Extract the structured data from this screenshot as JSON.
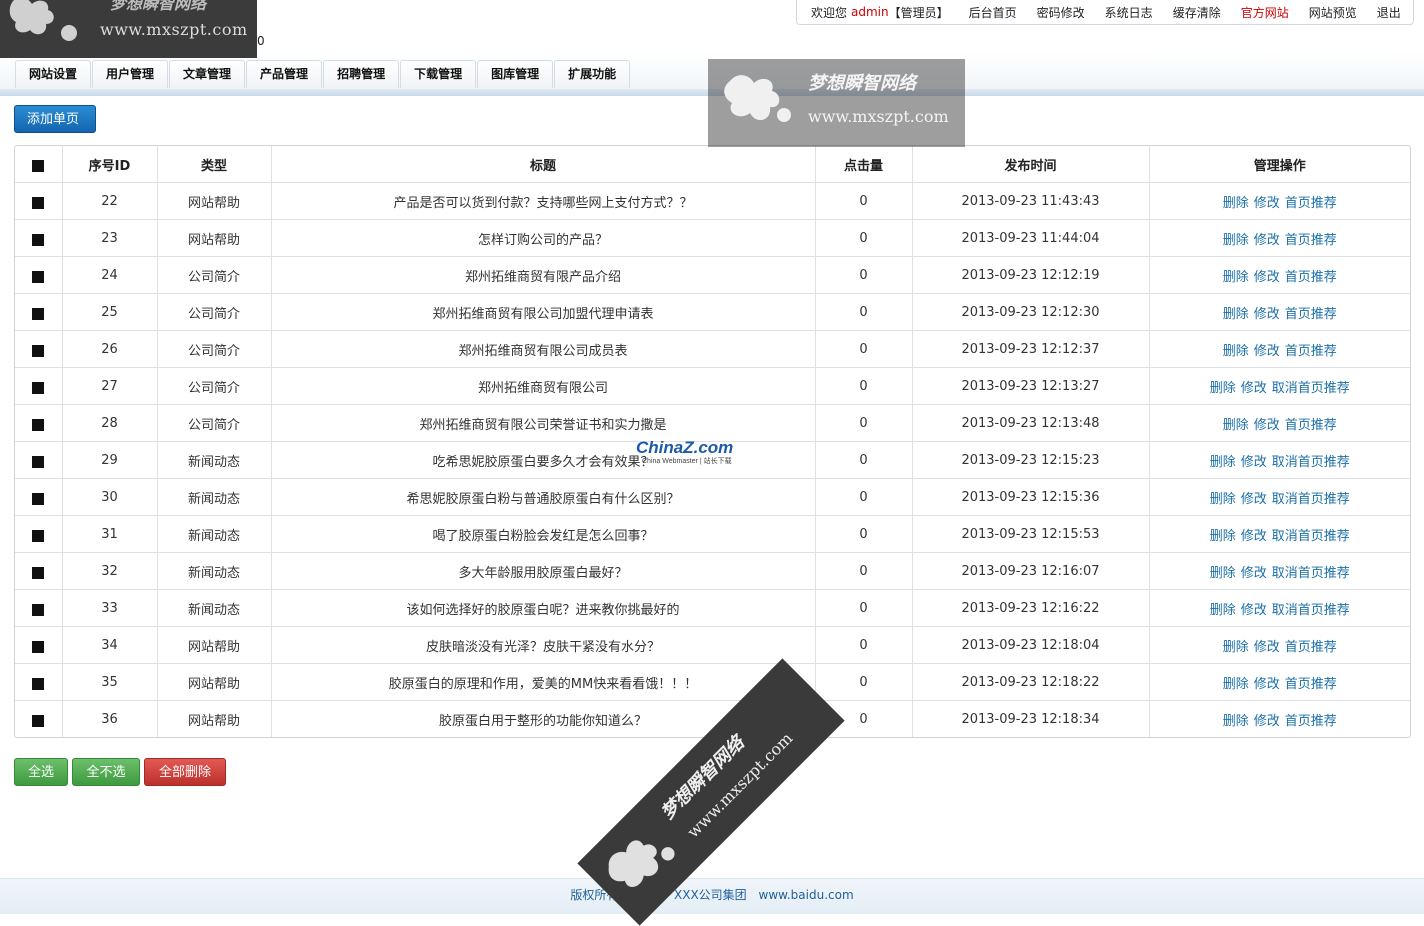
{
  "logo": {
    "url_text": "www.mxszpt.com",
    "tail_text": "0"
  },
  "toplinks": {
    "welcome_prefix": "欢迎您",
    "username": "admin",
    "role": "【管理员】",
    "links": [
      {
        "label": "后台首页"
      },
      {
        "label": "密码修改"
      },
      {
        "label": "系统日志"
      },
      {
        "label": "缓存清除"
      },
      {
        "label": "官方网站",
        "color": "#cc0000"
      },
      {
        "label": "网站预览"
      },
      {
        "label": "退出"
      }
    ]
  },
  "nav": {
    "tabs": [
      {
        "label": "网站设置"
      },
      {
        "label": "用户管理"
      },
      {
        "label": "文章管理"
      },
      {
        "label": "产品管理"
      },
      {
        "label": "招聘管理"
      },
      {
        "label": "下载管理"
      },
      {
        "label": "图库管理"
      },
      {
        "label": "扩展功能"
      }
    ]
  },
  "toolbar": {
    "add_page_label": "添加单页"
  },
  "table": {
    "headers": {
      "id": "序号ID",
      "type": "类型",
      "title": "标题",
      "clicks": "点击量",
      "date": "发布时间",
      "actions": "管理操作"
    },
    "rows": [
      {
        "id": "22",
        "type": "网站帮助",
        "title": "产品是否可以货到付款？支持哪些网上支付方式？？",
        "clicks": "0",
        "date": "2013-09-23 11:43:43",
        "actions": [
          "删除",
          "修改",
          "首页推荐"
        ]
      },
      {
        "id": "23",
        "type": "网站帮助",
        "title": "怎样订购公司的产品？",
        "clicks": "0",
        "date": "2013-09-23 11:44:04",
        "actions": [
          "删除",
          "修改",
          "首页推荐"
        ]
      },
      {
        "id": "24",
        "type": "公司简介",
        "title": "郑州拓维商贸有限产品介绍",
        "clicks": "0",
        "date": "2013-09-23 12:12:19",
        "actions": [
          "删除",
          "修改",
          "首页推荐"
        ]
      },
      {
        "id": "25",
        "type": "公司简介",
        "title": "郑州拓维商贸有限公司加盟代理申请表",
        "clicks": "0",
        "date": "2013-09-23 12:12:30",
        "actions": [
          "删除",
          "修改",
          "首页推荐"
        ]
      },
      {
        "id": "26",
        "type": "公司简介",
        "title": "郑州拓维商贸有限公司成员表",
        "clicks": "0",
        "date": "2013-09-23 12:12:37",
        "actions": [
          "删除",
          "修改",
          "首页推荐"
        ]
      },
      {
        "id": "27",
        "type": "公司简介",
        "title": "郑州拓维商贸有限公司",
        "clicks": "0",
        "date": "2013-09-23 12:13:27",
        "actions": [
          "删除",
          "修改",
          "取消首页推荐"
        ]
      },
      {
        "id": "28",
        "type": "公司简介",
        "title": "郑州拓维商贸有限公司荣誉证书和实力撒是",
        "clicks": "0",
        "date": "2013-09-23 12:13:48",
        "actions": [
          "删除",
          "修改",
          "首页推荐"
        ]
      },
      {
        "id": "29",
        "type": "新闻动态",
        "title": "吃希思妮胶原蛋白要多久才会有效果？",
        "clicks": "0",
        "date": "2013-09-23 12:15:23",
        "actions": [
          "删除",
          "修改",
          "取消首页推荐"
        ]
      },
      {
        "id": "30",
        "type": "新闻动态",
        "title": "希思妮胶原蛋白粉与普通胶原蛋白有什么区别？",
        "clicks": "0",
        "date": "2013-09-23 12:15:36",
        "actions": [
          "删除",
          "修改",
          "取消首页推荐"
        ]
      },
      {
        "id": "31",
        "type": "新闻动态",
        "title": "喝了胶原蛋白粉脸会发红是怎么回事？",
        "clicks": "0",
        "date": "2013-09-23 12:15:53",
        "actions": [
          "删除",
          "修改",
          "取消首页推荐"
        ]
      },
      {
        "id": "32",
        "type": "新闻动态",
        "title": "多大年龄服用胶原蛋白最好？",
        "clicks": "0",
        "date": "2013-09-23 12:16:07",
        "actions": [
          "删除",
          "修改",
          "取消首页推荐"
        ]
      },
      {
        "id": "33",
        "type": "新闻动态",
        "title": "该如何选择好的胶原蛋白呢？进来教你挑最好的",
        "clicks": "0",
        "date": "2013-09-23 12:16:22",
        "actions": [
          "删除",
          "修改",
          "取消首页推荐"
        ]
      },
      {
        "id": "34",
        "type": "网站帮助",
        "title": "皮肤暗淡没有光泽？皮肤干紧没有水分？",
        "clicks": "0",
        "date": "2013-09-23 12:18:04",
        "actions": [
          "删除",
          "修改",
          "首页推荐"
        ]
      },
      {
        "id": "35",
        "type": "网站帮助",
        "title": "胶原蛋白的原理和作用，爱美的MM快来看看饿！！！",
        "clicks": "0",
        "date": "2013-09-23 12:18:22",
        "actions": [
          "删除",
          "修改",
          "首页推荐"
        ]
      },
      {
        "id": "36",
        "type": "网站帮助",
        "title": "胶原蛋白用于整形的功能你知道么？",
        "clicks": "0",
        "date": "2013-09-23 12:18:34",
        "actions": [
          "删除",
          "修改",
          "首页推荐"
        ]
      }
    ]
  },
  "bottom_actions": {
    "select_all": "全选",
    "select_none": "全不选",
    "delete_all": "全部删除"
  },
  "footer": {
    "prefix": "版权所有",
    "company": "XXX公司集团",
    "site": "www.baidu.com"
  },
  "watermarks": {
    "brand_cn": "梦想瞬智网络",
    "brand_url": "www.mxszpt.com",
    "chinaz_big": "ChinaZ.com",
    "chinaz_small": "China Webmaster | 站长下载"
  },
  "colors": {
    "primary_blue": "#1565b0",
    "link_blue": "#1a6fa8",
    "green": "#3e9a3e",
    "red": "#bc302b",
    "admin_red": "#cc0000"
  }
}
